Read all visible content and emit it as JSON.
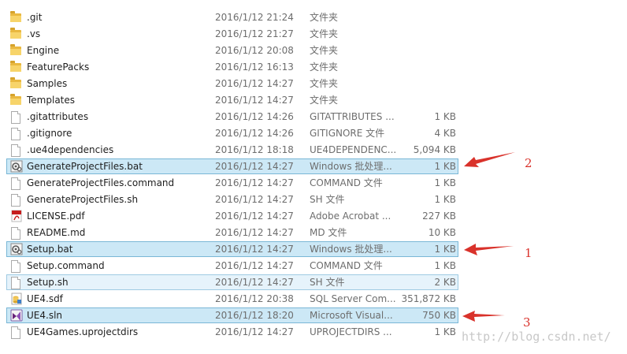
{
  "files": [
    {
      "name": ".git",
      "date": "2016/1/12 21:24",
      "type": "文件夹",
      "size": "",
      "icon": "folder-icon",
      "selection": "none"
    },
    {
      "name": ".vs",
      "date": "2016/1/12 21:27",
      "type": "文件夹",
      "size": "",
      "icon": "folder-icon",
      "selection": "none"
    },
    {
      "name": "Engine",
      "date": "2016/1/12 20:08",
      "type": "文件夹",
      "size": "",
      "icon": "folder-icon",
      "selection": "none"
    },
    {
      "name": "FeaturePacks",
      "date": "2016/1/12 16:13",
      "type": "文件夹",
      "size": "",
      "icon": "folder-icon",
      "selection": "none"
    },
    {
      "name": "Samples",
      "date": "2016/1/12 14:27",
      "type": "文件夹",
      "size": "",
      "icon": "folder-icon",
      "selection": "none"
    },
    {
      "name": "Templates",
      "date": "2016/1/12 14:27",
      "type": "文件夹",
      "size": "",
      "icon": "folder-icon",
      "selection": "none"
    },
    {
      "name": ".gitattributes",
      "date": "2016/1/12 14:26",
      "type": "GITATTRIBUTES ...",
      "size": "1 KB",
      "icon": "file-icon",
      "selection": "none"
    },
    {
      "name": ".gitignore",
      "date": "2016/1/12 14:26",
      "type": "GITIGNORE 文件",
      "size": "4 KB",
      "icon": "file-icon",
      "selection": "none"
    },
    {
      "name": ".ue4dependencies",
      "date": "2016/1/12 18:18",
      "type": "UE4DEPENDENC...",
      "size": "5,094 KB",
      "icon": "file-icon",
      "selection": "none"
    },
    {
      "name": "GenerateProjectFiles.bat",
      "date": "2016/1/12 14:27",
      "type": "Windows 批处理...",
      "size": "1 KB",
      "icon": "batch-file-icon",
      "selection": "dark"
    },
    {
      "name": "GenerateProjectFiles.command",
      "date": "2016/1/12 14:27",
      "type": "COMMAND 文件",
      "size": "1 KB",
      "icon": "file-icon",
      "selection": "none"
    },
    {
      "name": "GenerateProjectFiles.sh",
      "date": "2016/1/12 14:27",
      "type": "SH 文件",
      "size": "1 KB",
      "icon": "file-icon",
      "selection": "none"
    },
    {
      "name": "LICENSE.pdf",
      "date": "2016/1/12 14:27",
      "type": "Adobe Acrobat ...",
      "size": "227 KB",
      "icon": "pdf-icon",
      "selection": "none"
    },
    {
      "name": "README.md",
      "date": "2016/1/12 14:27",
      "type": "MD 文件",
      "size": "10 KB",
      "icon": "file-icon",
      "selection": "none"
    },
    {
      "name": "Setup.bat",
      "date": "2016/1/12 14:27",
      "type": "Windows 批处理...",
      "size": "1 KB",
      "icon": "batch-file-icon",
      "selection": "dark"
    },
    {
      "name": "Setup.command",
      "date": "2016/1/12 14:27",
      "type": "COMMAND 文件",
      "size": "1 KB",
      "icon": "file-icon",
      "selection": "none"
    },
    {
      "name": "Setup.sh",
      "date": "2016/1/12 14:27",
      "type": "SH 文件",
      "size": "2 KB",
      "icon": "file-icon",
      "selection": "light"
    },
    {
      "name": "UE4.sdf",
      "date": "2016/1/12 20:38",
      "type": "SQL Server Com...",
      "size": "351,872 KB",
      "icon": "sql-database-icon",
      "selection": "none"
    },
    {
      "name": "UE4.sln",
      "date": "2016/1/12 18:20",
      "type": "Microsoft Visual...",
      "size": "750 KB",
      "icon": "visual-studio-solution-icon",
      "selection": "dark"
    },
    {
      "name": "UE4Games.uprojectdirs",
      "date": "2016/1/12 14:27",
      "type": "UPROJECTDIRS ...",
      "size": "1 KB",
      "icon": "file-icon",
      "selection": "none"
    }
  ],
  "annotations": [
    {
      "label": "2",
      "color": "#d9322b"
    },
    {
      "label": "1",
      "color": "#d9322b"
    },
    {
      "label": "3",
      "color": "#d9322b"
    }
  ],
  "watermark": "http://blog.csdn.net/"
}
